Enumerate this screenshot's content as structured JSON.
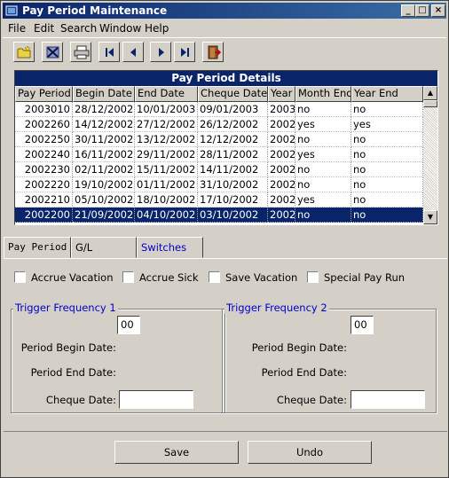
{
  "window": {
    "title": "Pay Period Maintenance",
    "controls": {
      "minimize": "_",
      "maximize": "□",
      "close": "×"
    }
  },
  "menu": [
    {
      "label": "File"
    },
    {
      "label": "Edit"
    },
    {
      "label": "Search"
    },
    {
      "label": "Window"
    },
    {
      "label": "Help"
    }
  ],
  "toolbar": {
    "icons": [
      "new-folder-icon",
      "delete-icon",
      "print-icon",
      "first-record-icon",
      "previous-record-icon",
      "next-record-icon",
      "last-record-icon",
      "exit-door-icon"
    ]
  },
  "grid": {
    "title": "Pay Period Details",
    "columns": [
      "Pay Period",
      "Begin Date",
      "End Date",
      "Cheque Date",
      "Year",
      "Month End",
      "Year End"
    ],
    "rows": [
      [
        "2003010",
        "28/12/2002",
        "10/01/2003",
        "09/01/2003",
        "2003",
        "no",
        "no"
      ],
      [
        "2002260",
        "14/12/2002",
        "27/12/2002",
        "26/12/2002",
        "2002",
        "yes",
        "yes"
      ],
      [
        "2002250",
        "30/11/2002",
        "13/12/2002",
        "12/12/2002",
        "2002",
        "no",
        "no"
      ],
      [
        "2002240",
        "16/11/2002",
        "29/11/2002",
        "28/11/2002",
        "2002",
        "yes",
        "no"
      ],
      [
        "2002230",
        "02/11/2002",
        "15/11/2002",
        "14/11/2002",
        "2002",
        "no",
        "no"
      ],
      [
        "2002220",
        "19/10/2002",
        "01/11/2002",
        "31/10/2002",
        "2002",
        "no",
        "no"
      ],
      [
        "2002210",
        "05/10/2002",
        "18/10/2002",
        "17/10/2002",
        "2002",
        "yes",
        "no"
      ],
      [
        "2002200",
        "21/09/2002",
        "04/10/2002",
        "03/10/2002",
        "2002",
        "no",
        "no"
      ]
    ],
    "selected_row": 7
  },
  "tabs": [
    {
      "label": "Pay Period"
    },
    {
      "label": "G/L"
    },
    {
      "label": "Switches"
    }
  ],
  "active_tab": "Switches",
  "switches": {
    "checkboxes": [
      {
        "label": "Accrue Vacation",
        "checked": false
      },
      {
        "label": "Accrue Sick",
        "checked": false
      },
      {
        "label": "Save Vacation",
        "checked": false
      },
      {
        "label": "Special Pay Run",
        "checked": false
      }
    ],
    "trigger1": {
      "title": "Trigger Frequency 1",
      "frequency": "00",
      "begin_label": "Period Begin Date:",
      "end_label": "Period End Date:",
      "cheque_label": "Cheque Date:",
      "cheque_value": ""
    },
    "trigger2": {
      "title": "Trigger Frequency 2",
      "frequency": "00",
      "begin_label": "Period Begin Date:",
      "end_label": "Period End Date:",
      "cheque_label": "Cheque Date:",
      "cheque_value": ""
    }
  },
  "buttons": {
    "save": "Save",
    "undo": "Undo"
  },
  "colors": {
    "title_bar": "#0a246a",
    "selection": "#0a246a",
    "group_title": "#0000cc",
    "face": "#d4d0c8"
  }
}
